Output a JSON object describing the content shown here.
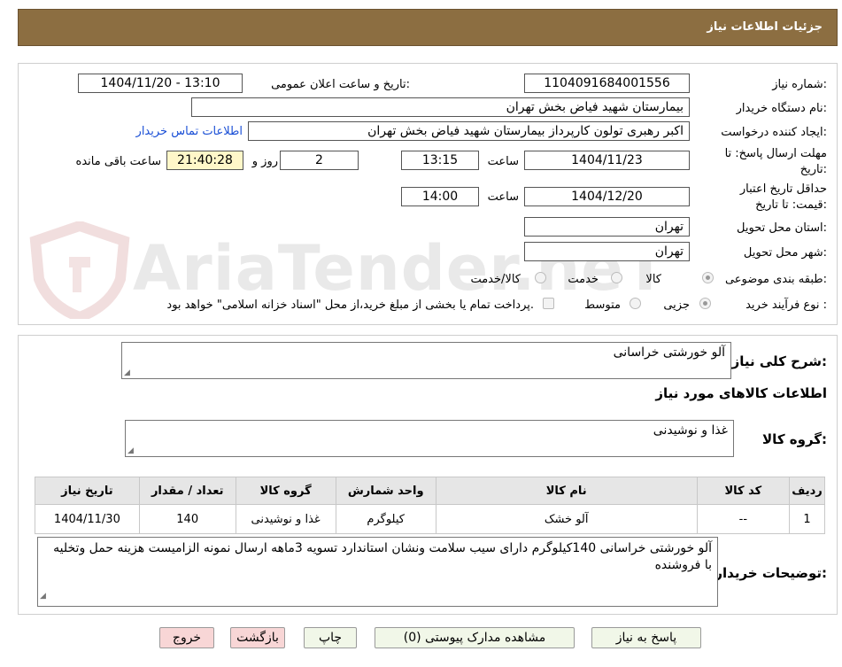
{
  "header": {
    "title": "جزئیات اطلاعات نیاز"
  },
  "watermark": {
    "text": "AriaTender.neT"
  },
  "form": {
    "need_number_label": "شماره نیاز:",
    "need_number": "1104091684001556",
    "announce_label": "تاریخ و ساعت اعلان عمومی:",
    "announce_value": "1404/11/20 - 13:10",
    "buyer_org_label": "نام دستگاه خریدار:",
    "buyer_org": "بیمارستان شهید فیاض بخش تهران",
    "creator_label": "ایجاد کننده درخواست:",
    "creator": "اکبر رهبری تولون کارپرداز بیمارستان شهید فیاض بخش تهران",
    "contact_link": "اطلاعات تماس خریدار",
    "deadline_label": "مهلت ارسال پاسخ: تا تاریخ:",
    "deadline_date": "1404/11/23",
    "time_label": "ساعت",
    "deadline_time": "13:15",
    "days_value": "2",
    "days_label": "روز و",
    "remaining_time": "21:40:28",
    "remaining_label": "ساعت باقی مانده",
    "validity_label": "حداقل تاریخ اعتبار قیمت: تا تاریخ:",
    "validity_date": "1404/12/20",
    "validity_time": "14:00",
    "province_label": "استان محل تحویل:",
    "province": "تهران",
    "city_label": "شهر محل تحویل:",
    "city": "تهران",
    "category_label": "طبقه بندی موضوعی:",
    "category_options": [
      "کالا",
      "خدمت",
      "کالا/خدمت"
    ],
    "category_selected": "کالا",
    "process_label": "نوع فرآیند خرید :",
    "process_options": [
      "جزیی",
      "متوسط"
    ],
    "process_selected": "جزیی",
    "payment_note": "پرداخت تمام یا بخشی از مبلغ خرید،از محل \"اسناد خزانه اسلامی\" خواهد بود."
  },
  "details": {
    "summary_label": "شرح کلی نیاز:",
    "summary": "آلو خورشتی خراسانی",
    "goods_info_title": "اطلاعات کالاهای مورد نیاز",
    "group_label": "گروه کالا:",
    "group": "غذا و نوشیدنی",
    "table": {
      "headers": [
        "ردیف",
        "کد کالا",
        "نام کالا",
        "واحد شمارش",
        "گروه کالا",
        "تعداد / مقدار",
        "تاریخ نیاز"
      ],
      "rows": [
        [
          "1",
          "--",
          "آلو خشک",
          "کیلوگرم",
          "غذا و نوشیدنی",
          "140",
          "1404/11/30"
        ]
      ]
    },
    "buyer_notes_label": "توضیحات خریدار:",
    "buyer_notes": "آلو خورشتی خراسانی 140کیلوگرم دارای سیب سلامت ونشان استاندارد تسویه 3ماهه ارسال نمونه الزامیست هزینه حمل وتخلیه با فروشنده"
  },
  "buttons": {
    "reply": "پاسخ به نیاز",
    "attachments": "مشاهده مدارک پیوستی (0)",
    "print": "چاپ",
    "back": "بازگشت",
    "exit": "خروج"
  },
  "colors": {
    "header_bg": "#8c6e41",
    "link": "#1a4fd6",
    "remaining_bg": "#fff7c9",
    "exit_bg": "#f8d6d6",
    "button_bg": "#f1f7e8"
  }
}
